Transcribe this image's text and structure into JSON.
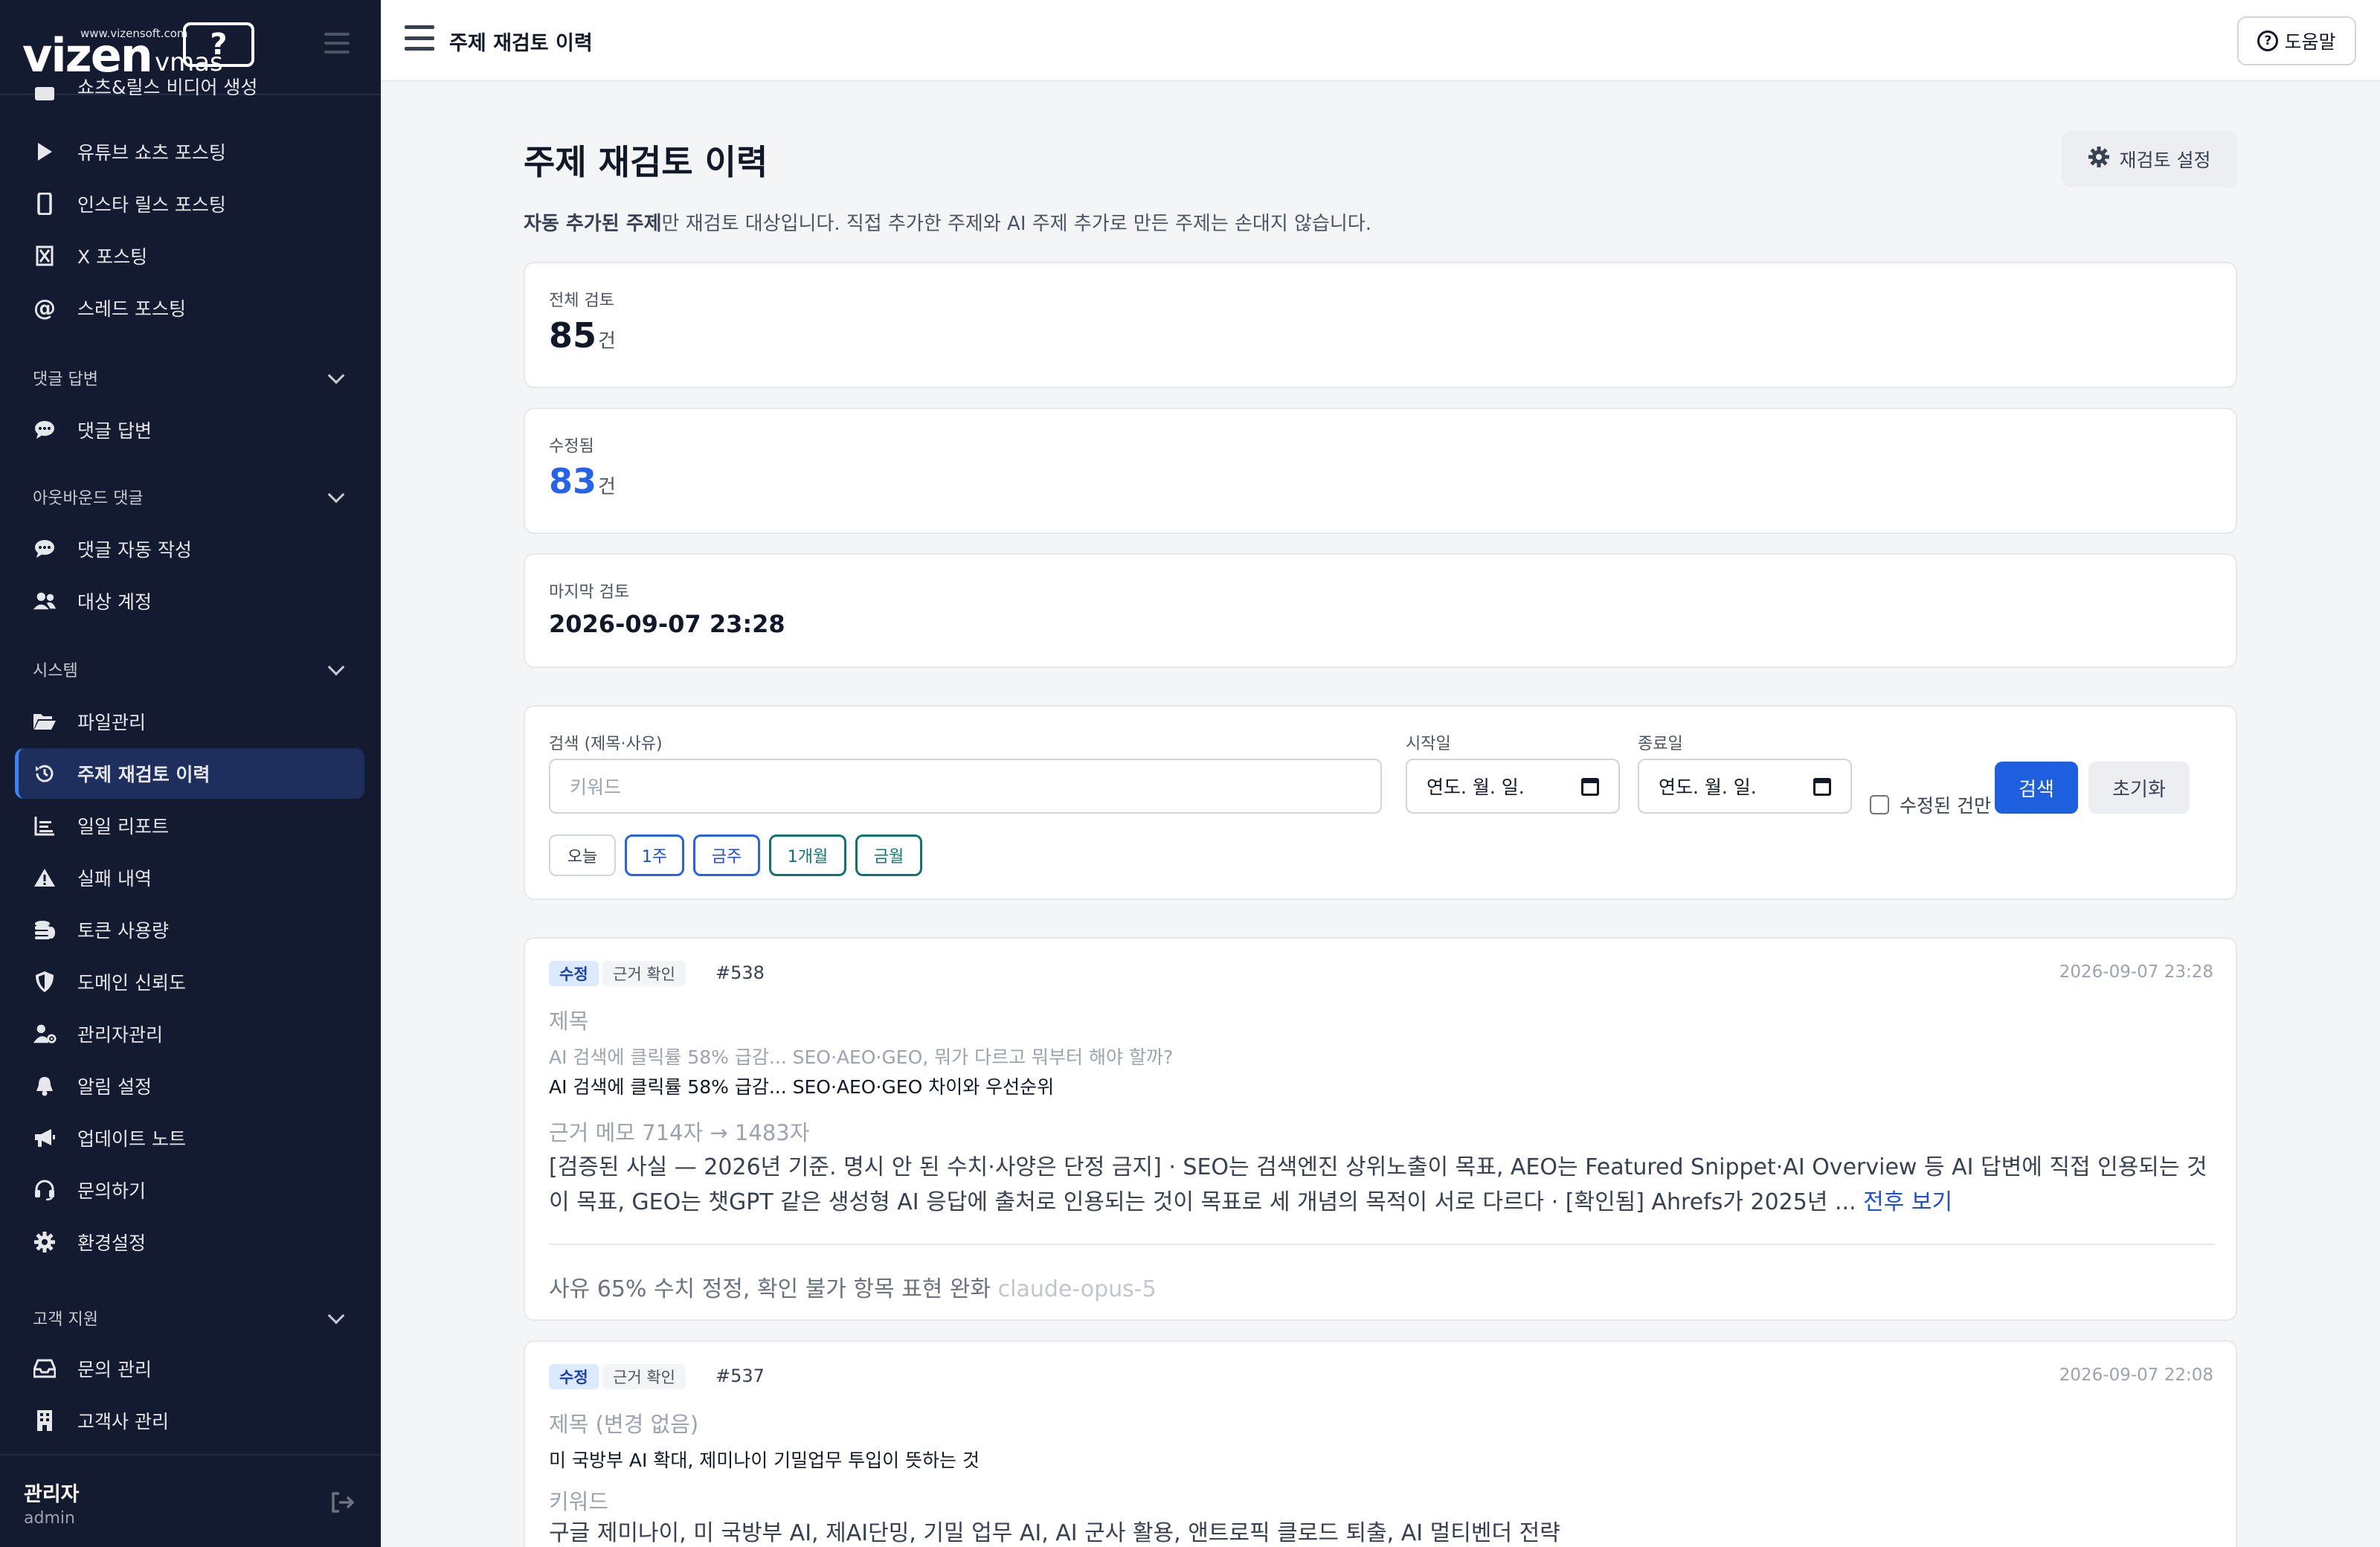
{
  "brand": {
    "name": "vizen",
    "sub": "vmas",
    "url": "www.vizensoft.com",
    "mark": "?"
  },
  "sidebar": {
    "partial_item": "쇼츠&릴스 비디어 생성",
    "items_top": [
      {
        "label": "유튜브 쇼츠 포스팅",
        "icon": "play-icon"
      },
      {
        "label": "인스타 릴스 포스팅",
        "icon": "mobile-icon"
      },
      {
        "label": "X 포스팅",
        "icon": "x-logo-icon"
      },
      {
        "label": "스레드 포스팅",
        "icon": "at-sign-icon"
      }
    ],
    "sections": [
      {
        "title": "댓글 답변",
        "items": [
          {
            "label": "댓글 답변",
            "icon": "comment-icon"
          }
        ]
      },
      {
        "title": "아웃바운드 댓글",
        "items": [
          {
            "label": "댓글 자동 작성",
            "icon": "comment-icon"
          },
          {
            "label": "대상 계정",
            "icon": "users-icon"
          }
        ]
      },
      {
        "title": "시스템",
        "items": [
          {
            "label": "파일관리",
            "icon": "folder-open-icon"
          },
          {
            "label": "주제 재검토 이력",
            "icon": "history-icon",
            "active": true
          },
          {
            "label": "일일 리포트",
            "icon": "chart-icon"
          },
          {
            "label": "실패 내역",
            "icon": "warning-icon"
          },
          {
            "label": "토큰 사용량",
            "icon": "coins-icon"
          },
          {
            "label": "도메인 신뢰도",
            "icon": "shield-icon"
          },
          {
            "label": "관리자관리",
            "icon": "user-gear-icon"
          },
          {
            "label": "알림 설정",
            "icon": "bell-icon"
          },
          {
            "label": "업데이트 노트",
            "icon": "megaphone-icon"
          },
          {
            "label": "문의하기",
            "icon": "headset-icon"
          },
          {
            "label": "환경설정",
            "icon": "gear-icon"
          }
        ]
      },
      {
        "title": "고객 지원",
        "items": [
          {
            "label": "문의 관리",
            "icon": "inbox-icon"
          },
          {
            "label": "고객사 관리",
            "icon": "building-icon"
          }
        ]
      }
    ],
    "user": {
      "name": "관리자",
      "role": "admin"
    }
  },
  "topbar": {
    "title": "주제 재검토 이력",
    "help_label": "도움말"
  },
  "page": {
    "title": "주제 재검토 이력",
    "settings_label": "재검토 설정",
    "desc_bold": "자동 추가된 주제",
    "desc_rest": "만 재검토 대상입니다. 직접 추가한 주제와 AI 주제 추가로 만든 주제는 손대지 않습니다."
  },
  "stats": [
    {
      "label": "전체 검토",
      "value": "85",
      "unit": "건"
    },
    {
      "label": "수정됨",
      "value": "83",
      "unit": "건"
    },
    {
      "label": "마지막 검토",
      "value": "2026-09-07 23:28"
    }
  ],
  "filter": {
    "search_label": "검색 (제목·사유)",
    "search_placeholder": "키워드",
    "start_label": "시작일",
    "start_value": "연도. 월. 일.",
    "end_label": "종료일",
    "end_value": "연도. 월. 일.",
    "checkbox_label": "수정된 건만",
    "search_btn": "검색",
    "reset_btn": "초기화",
    "ranges": [
      "오늘",
      "1주",
      "금주",
      "1개월",
      "금월"
    ]
  },
  "records": [
    {
      "badge_edit": "수정",
      "badge_check": "근거 확인",
      "id": "#538",
      "date": "2026-09-07 23:28",
      "title_label": "제목",
      "old_title": "AI 검색에 클릭률 58% 급감... SEO·AEO·GEO, 뭐가 다르고 뭐부터 해야 할까?",
      "new_title": "AI 검색에 클릭률 58% 급감... SEO·AEO·GEO 차이와 우선순위",
      "memo_label": "근거 메모 714자 → 1483자",
      "memo_body": "[검증된 사실 — 2026년 기준. 명시 안 된 수치·사양은 단정 금지] · SEO는 검색엔진 상위노출이 목표, AEO는 Featured Snippet·AI Overview 등 AI 답변에 직접 인용되는 것이 목표, GEO는 챗GPT 같은 생성형 AI 응답에 출처로 인용되는 것이 목표로 세 개념의 목적이 서로 다르다 · [확인됨] Ahrefs가 2025년 ...",
      "more": "전후 보기",
      "reason": "사유 65% 수치 정정, 확인 불가 항목 표현 완화",
      "model": "claude-opus-5"
    },
    {
      "badge_edit": "수정",
      "badge_check": "근거 확인",
      "id": "#537",
      "date": "2026-09-07 22:08",
      "title_label": "제목 (변경 없음)",
      "new_title": "미 국방부 AI 확대, 제미나이 기밀업무 투입이 뜻하는 것",
      "kw_label": "키워드",
      "keywords": "구글 제미나이, 미 국방부 AI, 제AI단밍, 기밀 업무 AI, AI 군사 활용, 앤트로픽 클로드 퇴출, AI 멀티벤더 전략"
    }
  ],
  "colors": {
    "sidebar_bg": "#141b30",
    "accent": "#1d5fde",
    "active_bg": "#1e2f5e"
  }
}
